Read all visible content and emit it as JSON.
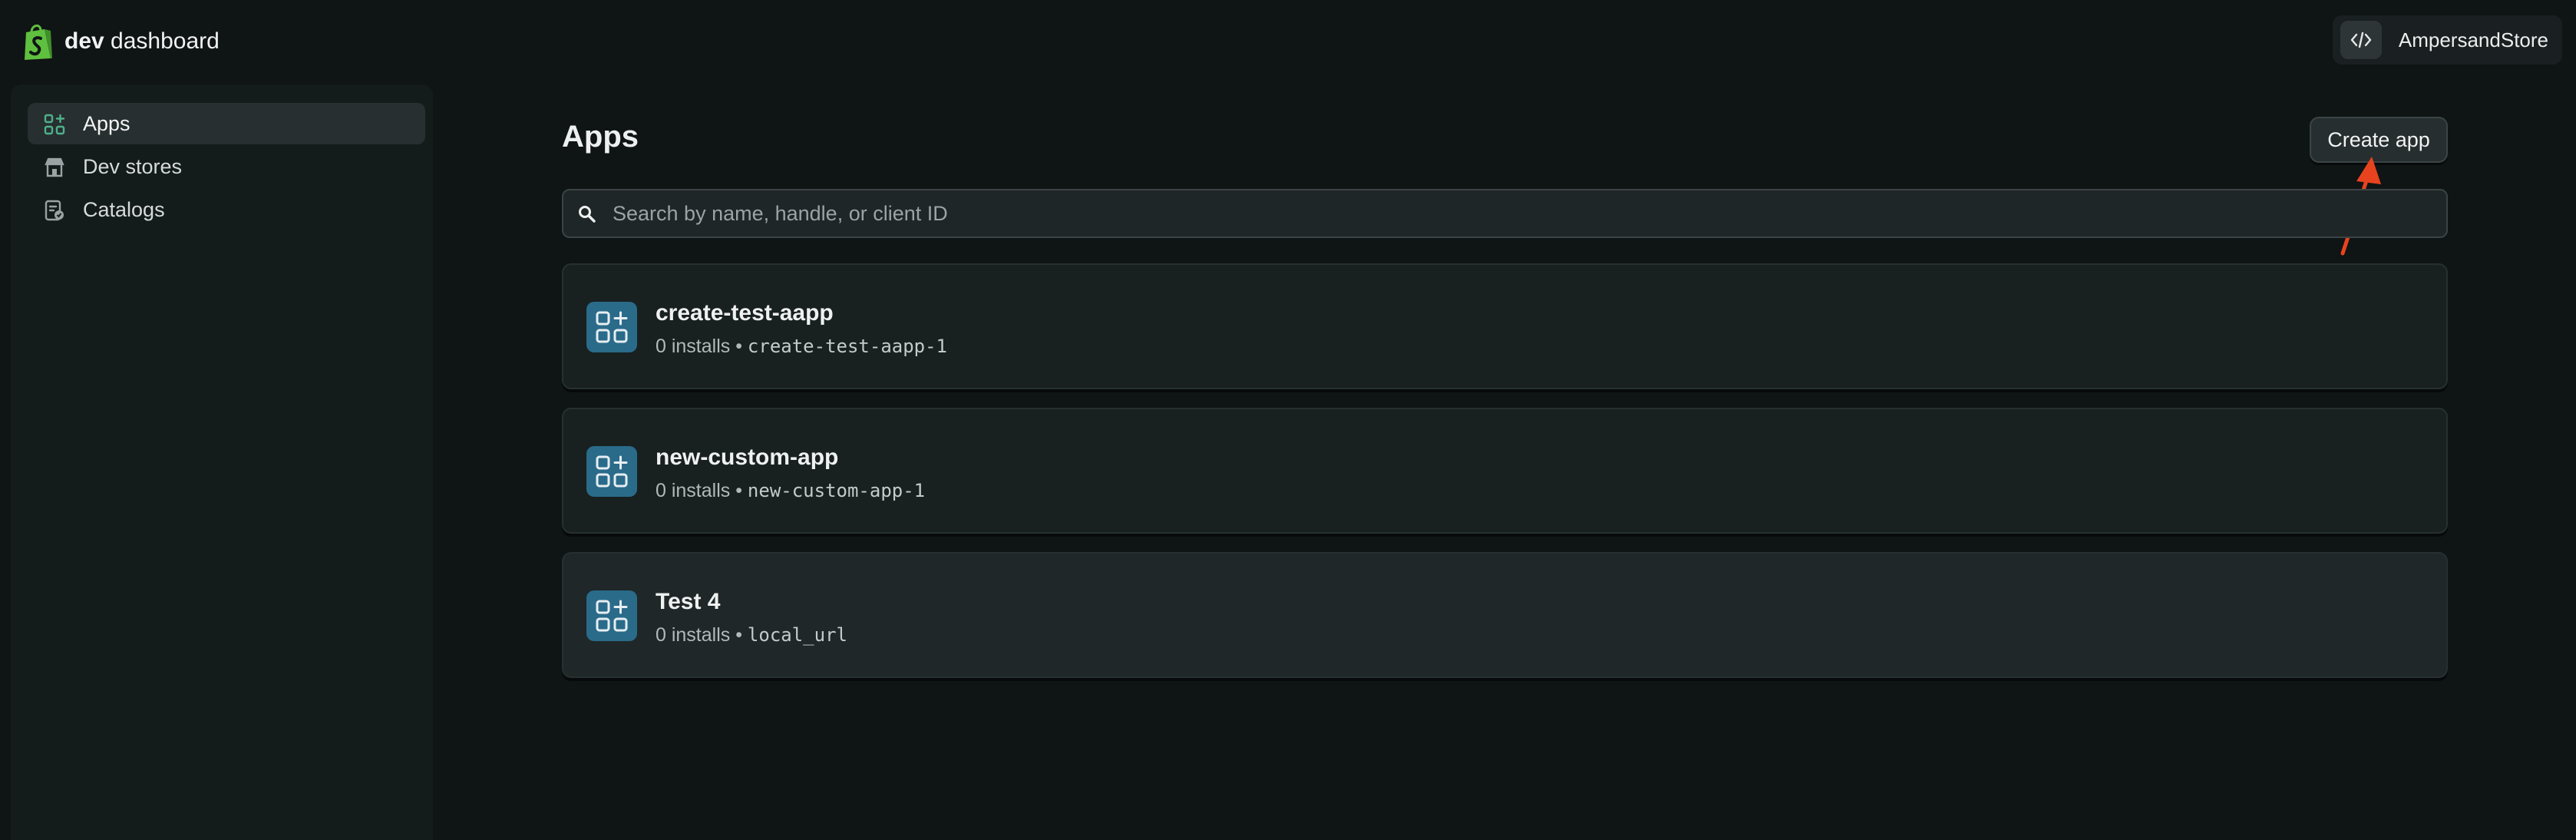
{
  "header": {
    "brand_bold": "dev",
    "brand_rest": " dashboard",
    "account_name": "AmpersandStore"
  },
  "sidebar": {
    "items": [
      {
        "label": "Apps",
        "icon": "apps-icon",
        "active": true
      },
      {
        "label": "Dev stores",
        "icon": "store-icon",
        "active": false
      },
      {
        "label": "Catalogs",
        "icon": "catalog-icon",
        "active": false
      }
    ]
  },
  "main": {
    "title": "Apps",
    "create_button_label": "Create app",
    "search": {
      "placeholder": "Search by name, handle, or client ID",
      "value": ""
    },
    "apps": [
      {
        "name": "create-test-aapp",
        "installs": "0 installs",
        "separator": " • ",
        "handle": "create-test-aapp-1"
      },
      {
        "name": "new-custom-app",
        "installs": "0 installs",
        "separator": " • ",
        "handle": "new-custom-app-1"
      },
      {
        "name": "Test 4",
        "installs": "0 installs",
        "separator": " • ",
        "handle": "local_url"
      }
    ]
  },
  "colors": {
    "background": "#0f1414",
    "app_icon_bg": "#2a6b8a",
    "brand_green": "#5fbf3f",
    "annotation_arrow": "#e8431f"
  }
}
